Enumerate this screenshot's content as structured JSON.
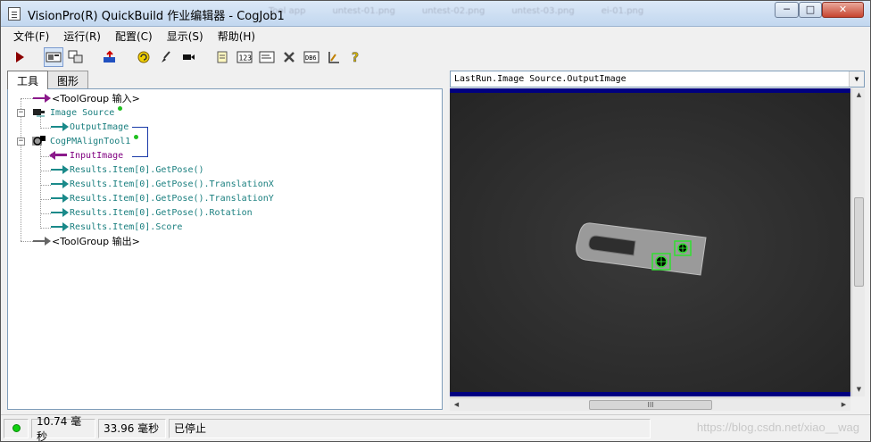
{
  "window": {
    "title": "VisionPro(R) QuickBuild 作业编辑器 - CogJob1",
    "min_label": "─",
    "max_label": "□",
    "close_label": "✕"
  },
  "background_tabs": [
    "Tool app",
    "untest-01.png",
    "untest-02.png",
    "untest-03.png",
    "ei-01.png"
  ],
  "menu": [
    "文件(F)",
    "运行(R)",
    "配置(C)",
    "显示(S)",
    "帮助(H)"
  ],
  "toolbar_icons": [
    "run-icon",
    "display-mode-icon",
    "window-mode-icon",
    "reset-icon",
    "refresh-icon",
    "brush-icon",
    "video-icon",
    "notes-icon",
    "numeric-icon",
    "terminal-icon",
    "tools-icon",
    "db-icon",
    "calibrate-icon",
    "help-icon"
  ],
  "left_tabs": [
    "工具",
    "图形"
  ],
  "tree": {
    "input_group": "<ToolGroup 输入>",
    "image_source": "Image Source",
    "output_image": "OutputImage",
    "pm_tool": "CogPMAlignTool1",
    "input_image": "InputImage",
    "results": [
      "Results.Item[0].GetPose()",
      "Results.Item[0].GetPose().TranslationX",
      "Results.Item[0].GetPose().TranslationY",
      "Results.Item[0].GetPose().Rotation",
      "Results.Item[0].Score"
    ],
    "output_group": "<ToolGroup 输出>"
  },
  "display": {
    "selector": "LastRun.Image Source.OutputImage",
    "hscroll_grip": "III"
  },
  "status": {
    "time1": "10.74 毫秒",
    "time2": "33.96 毫秒",
    "state": "已停止"
  },
  "watermark": "https://blog.csdn.net/xiao__wag",
  "colors": {
    "teal": "#1a8a8a",
    "purple": "#8b1a8b",
    "link_blue": "#1a3aa8",
    "display_border": "#000080",
    "status_led": "#10d010",
    "match_box": "#30e030"
  }
}
